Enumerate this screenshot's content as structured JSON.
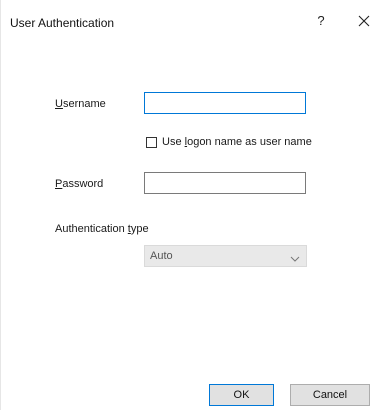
{
  "window": {
    "title": "User Authentication",
    "help_label": "?"
  },
  "form": {
    "username": {
      "label_accel": "U",
      "label_rest": "sername",
      "value": ""
    },
    "use_logon": {
      "label_pre": "Use ",
      "label_accel": "l",
      "label_rest": "ogon name as user name",
      "checked": false
    },
    "password": {
      "label_accel": "P",
      "label_rest": "assword",
      "value": ""
    },
    "auth_type": {
      "label_pre": "Authentication ",
      "label_accel": "t",
      "label_rest": "ype",
      "selected": "Auto"
    }
  },
  "buttons": {
    "ok": "OK",
    "cancel": "Cancel"
  }
}
